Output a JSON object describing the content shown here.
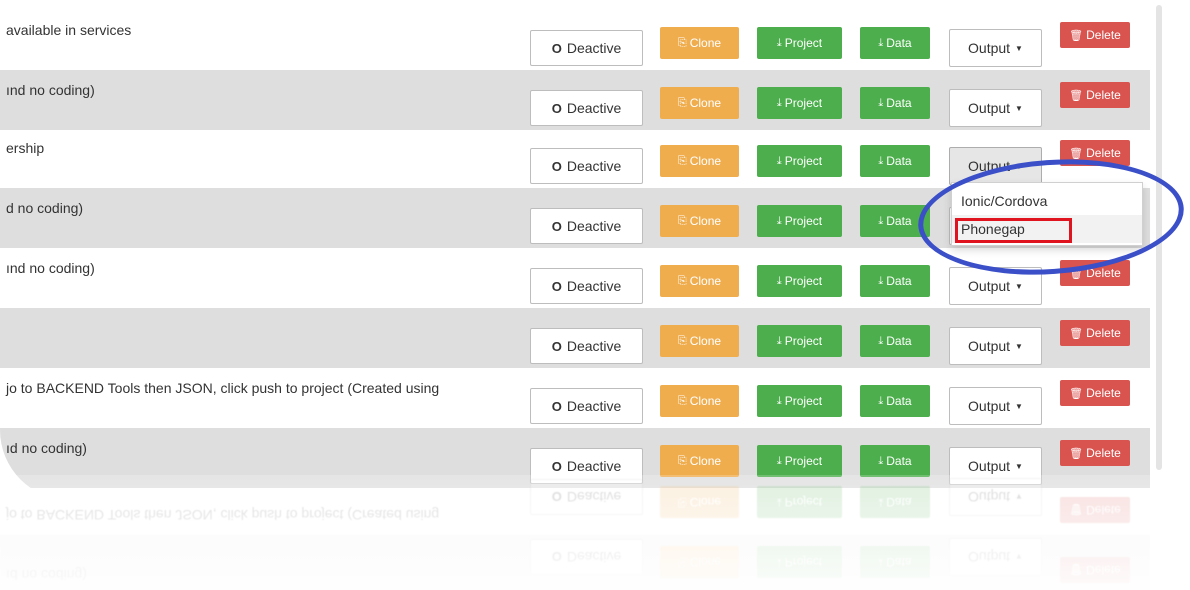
{
  "rows": [
    {
      "desc": "available in services"
    },
    {
      "desc": "ınd no coding)"
    },
    {
      "desc": "ership"
    },
    {
      "desc": "d no coding)"
    },
    {
      "desc": "ınd no coding)"
    },
    {
      "desc": ""
    },
    {
      "desc": "jo to BACKEND Tools then JSON, click push to project (Created using"
    },
    {
      "desc": "ıd no coding)"
    }
  ],
  "buttons": {
    "deactive": "Deactive",
    "clone": "Clone",
    "project": "Project",
    "data": "Data",
    "output": "Output",
    "delete": "Delete"
  },
  "output_menu": {
    "items": [
      "Ionic/Cordova",
      "Phonegap"
    ],
    "highlighted": "Phonegap"
  },
  "reflection": {
    "rows": [
      {
        "desc": "ıd no coding)"
      },
      {
        "desc": "jo to BACKEND Tools then JSON, click push to project (Created using"
      }
    ]
  },
  "colors": {
    "clone": "#f0ad4e",
    "project": "#4cae4c",
    "data": "#4cae4c",
    "delete": "#d9534f",
    "alt_row": "#dedede",
    "highlight_box": "#e0141e",
    "annotation_ellipse": "#3a4fc8"
  },
  "icons": {
    "deactive": "circle-icon",
    "clone": "copy-icon",
    "project": "download-icon",
    "data": "download-icon",
    "output": "caret-down-icon",
    "delete": "trash-icon"
  }
}
